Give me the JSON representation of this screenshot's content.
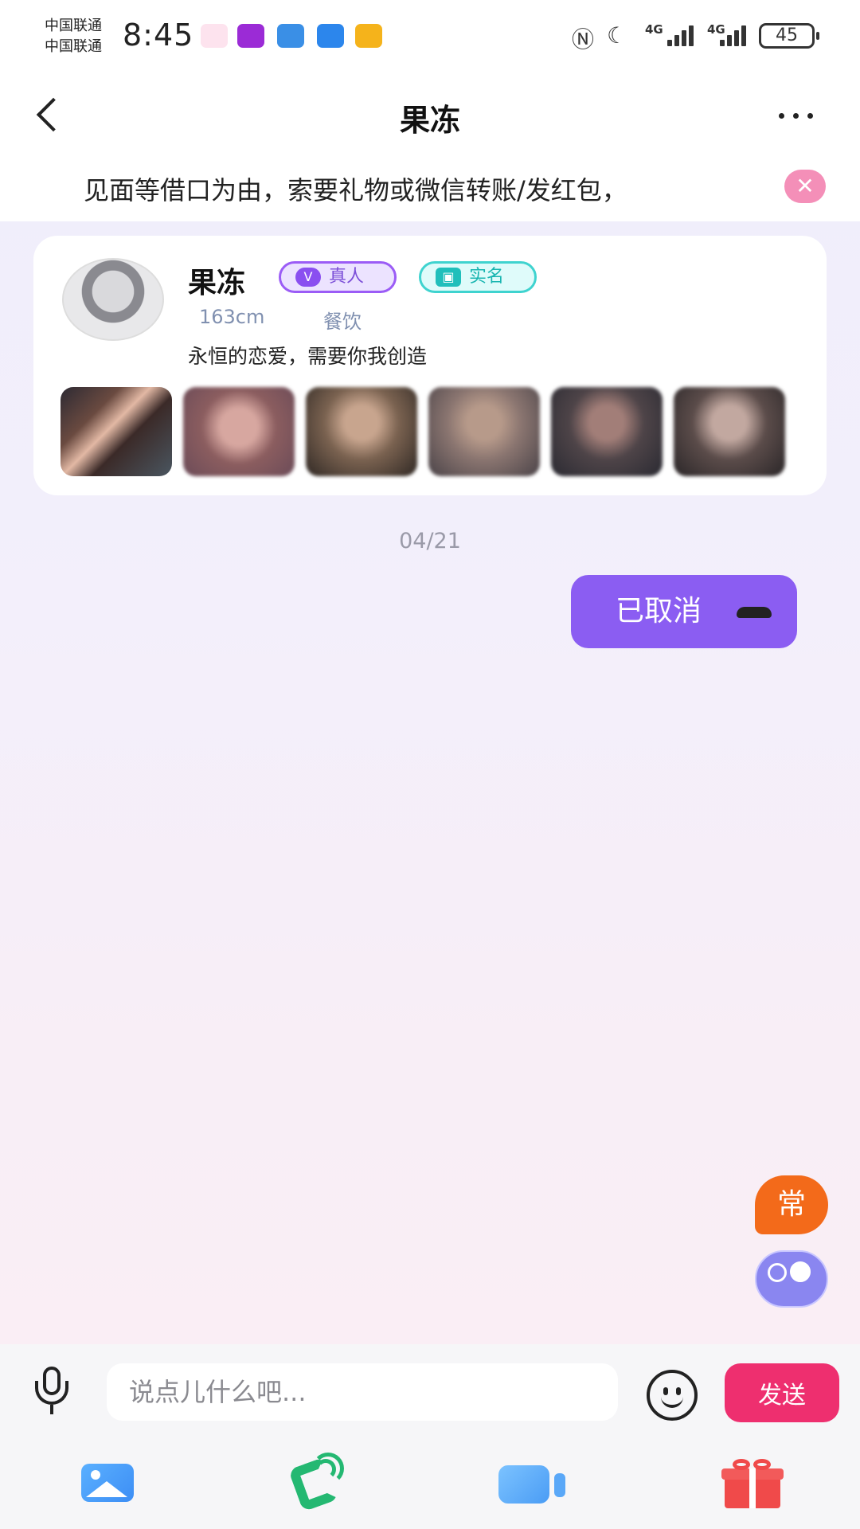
{
  "status_bar": {
    "carrier_1": "中国联通",
    "carrier_2": "中国联通",
    "time": "8:45",
    "network_1": "4G",
    "network_2": "4G",
    "battery": "45",
    "icons": [
      "heart-app-icon",
      "video-app-icon",
      "weather-icon",
      "message-icon",
      "weibo-icon",
      "nfc-icon",
      "moon-icon"
    ]
  },
  "header": {
    "title": "果冻"
  },
  "notice": {
    "text": "见面等借口为由，索要礼物或微信转账/发红包，"
  },
  "profile": {
    "name": "果冻",
    "badge_real": "真人",
    "badge_real_icon": "V",
    "badge_id": "实名",
    "height": "163cm",
    "occupation": "餐饮",
    "bio": "永恒的恋爱，需要你我创造",
    "photo_count": 6
  },
  "chat": {
    "date": "04/21",
    "messages": [
      {
        "from": "me",
        "type": "call",
        "text": "已取消"
      }
    ]
  },
  "floating": {
    "phrase_button": "常"
  },
  "composer": {
    "placeholder": "说点儿什么吧...",
    "value": "",
    "send_label": "发送"
  },
  "toolbar": {
    "items": [
      "gallery-icon",
      "voice-call-icon",
      "video-call-icon",
      "gift-icon"
    ]
  },
  "colors": {
    "accent_purple": "#8b5df2",
    "send_pink": "#ee2f6f",
    "badge_teal": "#3fd3cf",
    "fab_orange": "#f36a1a"
  }
}
